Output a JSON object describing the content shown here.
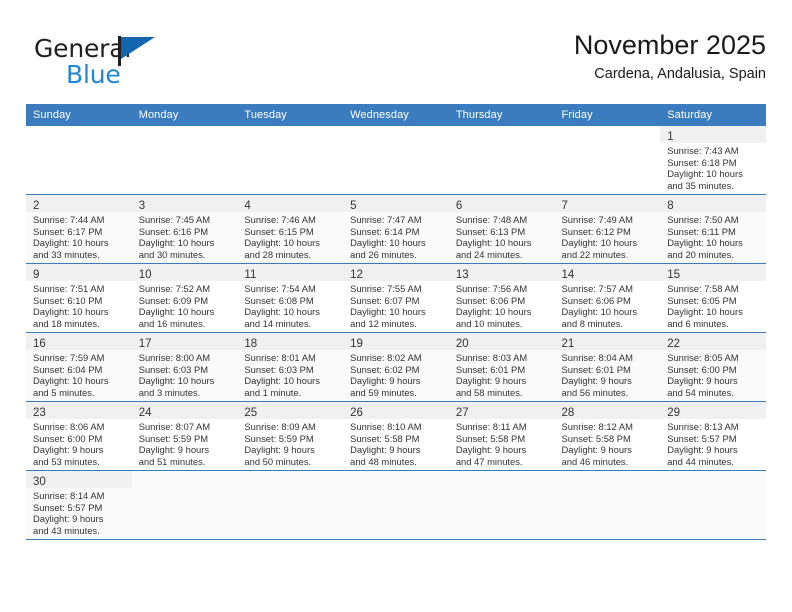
{
  "brand": {
    "word_one": "General",
    "word_two": "Blue",
    "flag_color": "#1266ae",
    "blue_color": "#1f87d8"
  },
  "header": {
    "title": "November 2025",
    "subtitle": "Cardena, Andalusia, Spain"
  },
  "theme": {
    "header_bar": "#3a7cbe",
    "daynum_bar": "#f0f0f0",
    "row_alt": "#fafafa",
    "text": "#333333"
  },
  "weekday_headers": [
    "Sunday",
    "Monday",
    "Tuesday",
    "Wednesday",
    "Thursday",
    "Friday",
    "Saturday"
  ],
  "weeks": [
    [
      {
        "day": "",
        "lines": []
      },
      {
        "day": "",
        "lines": []
      },
      {
        "day": "",
        "lines": []
      },
      {
        "day": "",
        "lines": []
      },
      {
        "day": "",
        "lines": []
      },
      {
        "day": "",
        "lines": []
      },
      {
        "day": "1",
        "lines": [
          "Sunrise: 7:43 AM",
          "Sunset: 6:18 PM",
          "Daylight: 10 hours",
          "and 35 minutes."
        ]
      }
    ],
    [
      {
        "day": "2",
        "lines": [
          "Sunrise: 7:44 AM",
          "Sunset: 6:17 PM",
          "Daylight: 10 hours",
          "and 33 minutes."
        ]
      },
      {
        "day": "3",
        "lines": [
          "Sunrise: 7:45 AM",
          "Sunset: 6:16 PM",
          "Daylight: 10 hours",
          "and 30 minutes."
        ]
      },
      {
        "day": "4",
        "lines": [
          "Sunrise: 7:46 AM",
          "Sunset: 6:15 PM",
          "Daylight: 10 hours",
          "and 28 minutes."
        ]
      },
      {
        "day": "5",
        "lines": [
          "Sunrise: 7:47 AM",
          "Sunset: 6:14 PM",
          "Daylight: 10 hours",
          "and 26 minutes."
        ]
      },
      {
        "day": "6",
        "lines": [
          "Sunrise: 7:48 AM",
          "Sunset: 6:13 PM",
          "Daylight: 10 hours",
          "and 24 minutes."
        ]
      },
      {
        "day": "7",
        "lines": [
          "Sunrise: 7:49 AM",
          "Sunset: 6:12 PM",
          "Daylight: 10 hours",
          "and 22 minutes."
        ]
      },
      {
        "day": "8",
        "lines": [
          "Sunrise: 7:50 AM",
          "Sunset: 6:11 PM",
          "Daylight: 10 hours",
          "and 20 minutes."
        ]
      }
    ],
    [
      {
        "day": "9",
        "lines": [
          "Sunrise: 7:51 AM",
          "Sunset: 6:10 PM",
          "Daylight: 10 hours",
          "and 18 minutes."
        ]
      },
      {
        "day": "10",
        "lines": [
          "Sunrise: 7:52 AM",
          "Sunset: 6:09 PM",
          "Daylight: 10 hours",
          "and 16 minutes."
        ]
      },
      {
        "day": "11",
        "lines": [
          "Sunrise: 7:54 AM",
          "Sunset: 6:08 PM",
          "Daylight: 10 hours",
          "and 14 minutes."
        ]
      },
      {
        "day": "12",
        "lines": [
          "Sunrise: 7:55 AM",
          "Sunset: 6:07 PM",
          "Daylight: 10 hours",
          "and 12 minutes."
        ]
      },
      {
        "day": "13",
        "lines": [
          "Sunrise: 7:56 AM",
          "Sunset: 6:06 PM",
          "Daylight: 10 hours",
          "and 10 minutes."
        ]
      },
      {
        "day": "14",
        "lines": [
          "Sunrise: 7:57 AM",
          "Sunset: 6:06 PM",
          "Daylight: 10 hours",
          "and 8 minutes."
        ]
      },
      {
        "day": "15",
        "lines": [
          "Sunrise: 7:58 AM",
          "Sunset: 6:05 PM",
          "Daylight: 10 hours",
          "and 6 minutes."
        ]
      }
    ],
    [
      {
        "day": "16",
        "lines": [
          "Sunrise: 7:59 AM",
          "Sunset: 6:04 PM",
          "Daylight: 10 hours",
          "and 5 minutes."
        ]
      },
      {
        "day": "17",
        "lines": [
          "Sunrise: 8:00 AM",
          "Sunset: 6:03 PM",
          "Daylight: 10 hours",
          "and 3 minutes."
        ]
      },
      {
        "day": "18",
        "lines": [
          "Sunrise: 8:01 AM",
          "Sunset: 6:03 PM",
          "Daylight: 10 hours",
          "and 1 minute."
        ]
      },
      {
        "day": "19",
        "lines": [
          "Sunrise: 8:02 AM",
          "Sunset: 6:02 PM",
          "Daylight: 9 hours",
          "and 59 minutes."
        ]
      },
      {
        "day": "20",
        "lines": [
          "Sunrise: 8:03 AM",
          "Sunset: 6:01 PM",
          "Daylight: 9 hours",
          "and 58 minutes."
        ]
      },
      {
        "day": "21",
        "lines": [
          "Sunrise: 8:04 AM",
          "Sunset: 6:01 PM",
          "Daylight: 9 hours",
          "and 56 minutes."
        ]
      },
      {
        "day": "22",
        "lines": [
          "Sunrise: 8:05 AM",
          "Sunset: 6:00 PM",
          "Daylight: 9 hours",
          "and 54 minutes."
        ]
      }
    ],
    [
      {
        "day": "23",
        "lines": [
          "Sunrise: 8:06 AM",
          "Sunset: 6:00 PM",
          "Daylight: 9 hours",
          "and 53 minutes."
        ]
      },
      {
        "day": "24",
        "lines": [
          "Sunrise: 8:07 AM",
          "Sunset: 5:59 PM",
          "Daylight: 9 hours",
          "and 51 minutes."
        ]
      },
      {
        "day": "25",
        "lines": [
          "Sunrise: 8:09 AM",
          "Sunset: 5:59 PM",
          "Daylight: 9 hours",
          "and 50 minutes."
        ]
      },
      {
        "day": "26",
        "lines": [
          "Sunrise: 8:10 AM",
          "Sunset: 5:58 PM",
          "Daylight: 9 hours",
          "and 48 minutes."
        ]
      },
      {
        "day": "27",
        "lines": [
          "Sunrise: 8:11 AM",
          "Sunset: 5:58 PM",
          "Daylight: 9 hours",
          "and 47 minutes."
        ]
      },
      {
        "day": "28",
        "lines": [
          "Sunrise: 8:12 AM",
          "Sunset: 5:58 PM",
          "Daylight: 9 hours",
          "and 46 minutes."
        ]
      },
      {
        "day": "29",
        "lines": [
          "Sunrise: 8:13 AM",
          "Sunset: 5:57 PM",
          "Daylight: 9 hours",
          "and 44 minutes."
        ]
      }
    ],
    [
      {
        "day": "30",
        "lines": [
          "Sunrise: 8:14 AM",
          "Sunset: 5:57 PM",
          "Daylight: 9 hours",
          "and 43 minutes."
        ]
      },
      {
        "day": "",
        "lines": []
      },
      {
        "day": "",
        "lines": []
      },
      {
        "day": "",
        "lines": []
      },
      {
        "day": "",
        "lines": []
      },
      {
        "day": "",
        "lines": []
      },
      {
        "day": "",
        "lines": []
      }
    ]
  ]
}
